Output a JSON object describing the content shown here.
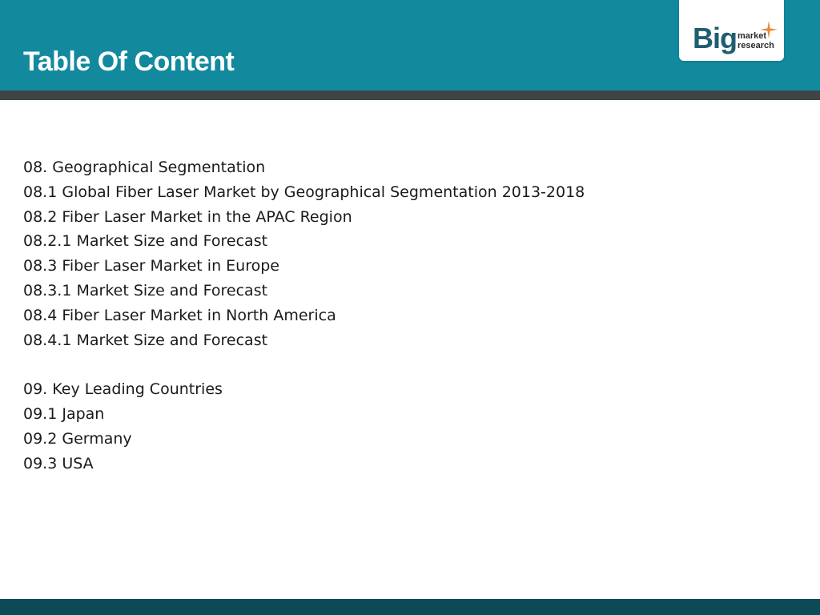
{
  "slide": {
    "title": "Table Of Content"
  },
  "logo": {
    "big": "Big",
    "line1": "market",
    "line2": "research",
    "star_icon": "sparkle-icon",
    "colors": {
      "big_text": "#1e5e70",
      "small_text": "#2b2b2b",
      "star": "#e8893a"
    }
  },
  "toc": {
    "section_08": [
      "08. Geographical Segmentation",
      "08.1 Global Fiber Laser Market by Geographical Segmentation 2013-2018",
      "08.2 Fiber Laser Market in the APAC Region",
      "08.2.1 Market Size and Forecast",
      "08.3 Fiber Laser Market in Europe",
      "08.3.1 Market Size and Forecast",
      "08.4 Fiber Laser Market in North America",
      "08.4.1 Market Size and Forecast"
    ],
    "section_09": [
      "09. Key Leading Countries",
      "09.1 Japan",
      "09.2 Germany",
      "09.3 USA"
    ]
  },
  "colors": {
    "header": "#13899e",
    "header_rule": "#3f4446",
    "footer": "#0d4a57",
    "title_text": "#ffffff",
    "body_text": "#1a1a1a"
  }
}
